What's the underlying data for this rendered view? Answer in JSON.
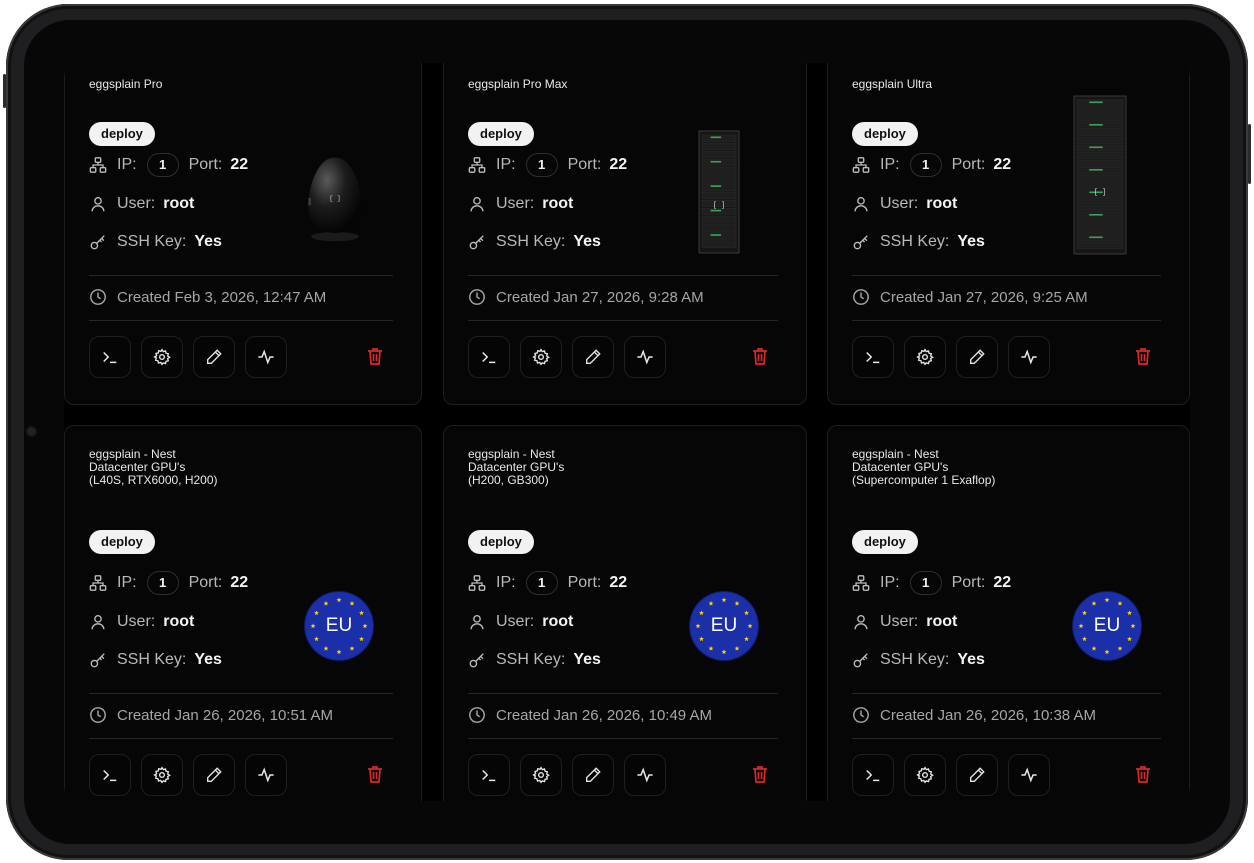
{
  "cards": [
    {
      "title": "eggsplain Pro",
      "deploy": "deploy",
      "ip_label": "IP:",
      "ip_value": "1",
      "port_label": "Port:",
      "port_value": "22",
      "user_label": "User:",
      "user_value": "root",
      "ssh_label": "SSH Key:",
      "ssh_value": "Yes",
      "created": "Created Feb 3, 2026, 12:47 AM",
      "image": "egg-device"
    },
    {
      "title": "eggsplain Pro Max",
      "deploy": "deploy",
      "ip_label": "IP:",
      "ip_value": "1",
      "port_label": "Port:",
      "port_value": "22",
      "user_label": "User:",
      "user_value": "root",
      "ssh_label": "SSH Key:",
      "ssh_value": "Yes",
      "created": "Created Jan 27, 2026, 9:28 AM",
      "image": "tower-server"
    },
    {
      "title": "eggsplain Ultra",
      "deploy": "deploy",
      "ip_label": "IP:",
      "ip_value": "1",
      "port_label": "Port:",
      "port_value": "22",
      "user_label": "User:",
      "user_value": "root",
      "ssh_label": "SSH Key:",
      "ssh_value": "Yes",
      "created": "Created Jan 27, 2026, 9:25 AM",
      "image": "rack-server"
    },
    {
      "title": "eggsplain - Nest\nDatacenter GPU's\n(L40S, RTX6000, H200)",
      "deploy": "deploy",
      "ip_label": "IP:",
      "ip_value": "1",
      "port_label": "Port:",
      "port_value": "22",
      "user_label": "User:",
      "user_value": "root",
      "ssh_label": "SSH Key:",
      "ssh_value": "Yes",
      "created": "Created Jan 26, 2026, 10:51 AM",
      "image": "eu-flag",
      "badge": "EU"
    },
    {
      "title": "eggsplain - Nest\nDatacenter GPU's\n(H200, GB300)",
      "deploy": "deploy",
      "ip_label": "IP:",
      "ip_value": "1",
      "port_label": "Port:",
      "port_value": "22",
      "user_label": "User:",
      "user_value": "root",
      "ssh_label": "SSH Key:",
      "ssh_value": "Yes",
      "created": "Created Jan 26, 2026, 10:49 AM",
      "image": "eu-flag",
      "badge": "EU"
    },
    {
      "title": "eggsplain - Nest\nDatacenter GPU's\n(Supercomputer 1 Exaflop)",
      "deploy": "deploy",
      "ip_label": "IP:",
      "ip_value": "1",
      "port_label": "Port:",
      "port_value": "22",
      "user_label": "User:",
      "user_value": "root",
      "ssh_label": "SSH Key:",
      "ssh_value": "Yes",
      "created": "Created Jan 26, 2026, 10:38 AM",
      "image": "eu-flag",
      "badge": "EU"
    }
  ],
  "actions": [
    "terminal-icon",
    "settings-icon",
    "edit-icon",
    "activity-icon"
  ],
  "colors": {
    "trash": "#d42a2a",
    "eu_blue": "#1b2fa8",
    "eu_star": "#ffd400"
  }
}
